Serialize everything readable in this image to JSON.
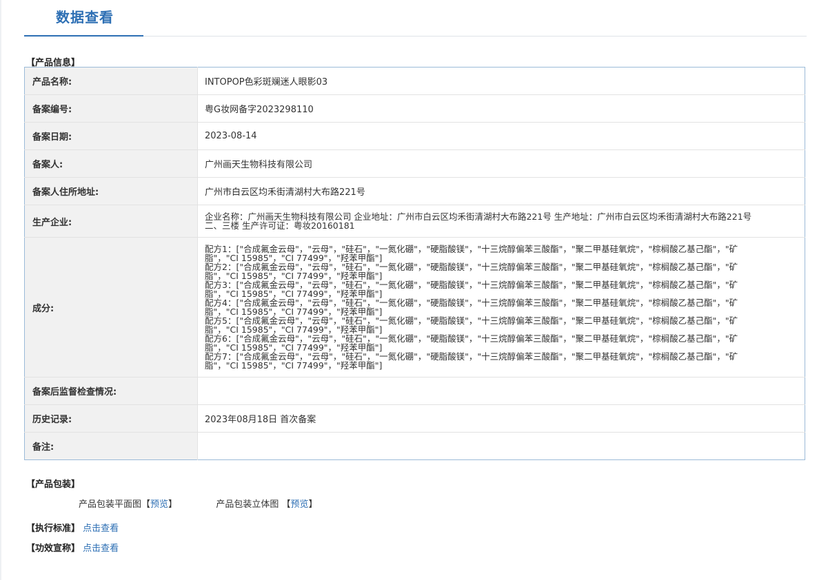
{
  "header": {
    "title": "数据查看"
  },
  "product_info": {
    "section_label": "【产品信息】",
    "rows": {
      "name": {
        "label": "产品名称:",
        "value": "INTOPOP色彩斑斓迷人眼影03"
      },
      "record_no": {
        "label": "备案编号:",
        "value": "粤G妆网备字2023298110"
      },
      "record_date": {
        "label": "备案日期:",
        "value": "2023-08-14"
      },
      "registrant": {
        "label": "备案人:",
        "value": "广州画天生物科技有限公司"
      },
      "address": {
        "label": "备案人住所地址:",
        "value": "广州市白云区均禾街清湖村大布路221号"
      },
      "producer": {
        "label": "生产企业:",
        "value": "企业名称：广州画天生物科技有限公司 企业地址：广州市白云区均禾街清湖村大布路221号 生产地址：广州市白云区均禾街清湖村大布路221号二、三楼 生产许可证：粤妆20160181"
      },
      "ingredients": {
        "label": "成分:",
        "lines": [
          "配方1：[\"合成氟金云母\"，\"云母\"，\"硅石\"，\"一氮化硼\"，\"硬脂酸镁\"，\"十三烷醇偏苯三酸酯\"，\"聚二甲基硅氧烷\"，\"棕榈酸乙基己酯\"，\"矿脂\"，\"CI 15985\"，\"CI 77499\"，\"羟苯甲酯\"]",
          "配方2：[\"合成氟金云母\"，\"云母\"，\"硅石\"，\"一氮化硼\"，\"硬脂酸镁\"，\"十三烷醇偏苯三酸酯\"，\"聚二甲基硅氧烷\"，\"棕榈酸乙基己酯\"，\"矿脂\"，\"CI 15985\"，\"CI 77499\"，\"羟苯甲酯\"]",
          "配方3：[\"合成氟金云母\"，\"云母\"，\"硅石\"，\"一氮化硼\"，\"硬脂酸镁\"，\"十三烷醇偏苯三酸酯\"，\"聚二甲基硅氧烷\"，\"棕榈酸乙基己酯\"，\"矿脂\"，\"CI 15985\"，\"CI 77499\"，\"羟苯甲酯\"]",
          "配方4：[\"合成氟金云母\"，\"云母\"，\"硅石\"，\"一氮化硼\"，\"硬脂酸镁\"，\"十三烷醇偏苯三酸酯\"，\"聚二甲基硅氧烷\"，\"棕榈酸乙基己酯\"，\"矿脂\"，\"CI 15985\"，\"CI 77499\"，\"羟苯甲酯\"]",
          "配方5：[\"合成氟金云母\"，\"云母\"，\"硅石\"，\"一氮化硼\"，\"硬脂酸镁\"，\"十三烷醇偏苯三酸酯\"，\"聚二甲基硅氧烷\"，\"棕榈酸乙基己酯\"，\"矿脂\"，\"CI 15985\"，\"CI 77499\"，\"羟苯甲酯\"]",
          "配方6：[\"合成氟金云母\"，\"云母\"，\"硅石\"，\"一氮化硼\"，\"硬脂酸镁\"，\"十三烷醇偏苯三酸酯\"，\"聚二甲基硅氧烷\"，\"棕榈酸乙基己酯\"，\"矿脂\"，\"CI 15985\"，\"CI 77499\"，\"羟苯甲酯\"]",
          "配方7：[\"合成氟金云母\"，\"云母\"，\"硅石\"，\"一氮化硼\"，\"硬脂酸镁\"，\"十三烷醇偏苯三酸酯\"，\"聚二甲基硅氧烷\"，\"棕榈酸乙基己酯\"，\"矿脂\"，\"CI 15985\"，\"CI 77499\"，\"羟苯甲酯\"]"
        ]
      },
      "inspection": {
        "label": "备案后监督检查情况:",
        "value": ""
      },
      "history": {
        "label": "历史记录:",
        "value": "2023年08月18日 首次备案"
      },
      "remarks": {
        "label": "备注:",
        "value": ""
      }
    }
  },
  "packaging": {
    "section_label": "【产品包装】",
    "flat_label": "产品包装平面图",
    "flat_link": "预览",
    "stereo_label": "产品包装立体图",
    "stereo_link": "预览",
    "bracket_open": "【",
    "bracket_close": "】"
  },
  "standard": {
    "label": "【执行标准】",
    "link": "点击查看"
  },
  "efficacy": {
    "label": "【功效宣称】",
    "link": "点击查看"
  },
  "colors": {
    "accent": "#2d6fb4",
    "table_border": "#9bbad8",
    "label_bg": "#f1f1f1"
  }
}
